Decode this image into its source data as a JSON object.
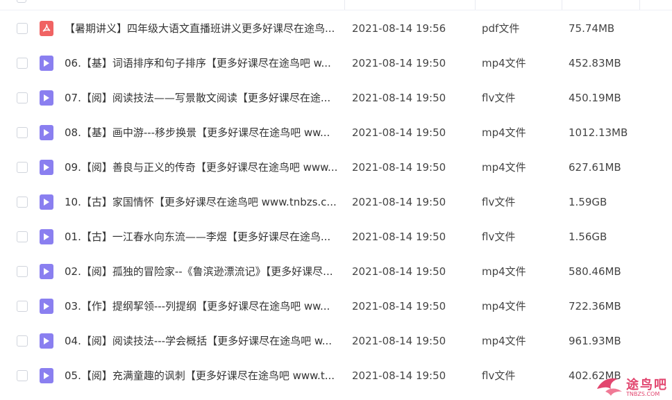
{
  "files": [
    {
      "name": "【暑期讲义】四年级大语文直播班讲义更多好课尽在途鸟...",
      "time": "2021-08-14 19:56",
      "type": "pdf文件",
      "size": "75.74MB",
      "icon": "pdf-file-icon"
    },
    {
      "name": "06.【基】词语排序和句子排序【更多好课尽在途鸟吧 w...",
      "time": "2021-08-14 19:50",
      "type": "mp4文件",
      "size": "452.83MB",
      "icon": "video-file-icon"
    },
    {
      "name": "07.【阅】阅读技法——写景散文阅读【更多好课尽在途...",
      "time": "2021-08-14 19:50",
      "type": "flv文件",
      "size": "450.19MB",
      "icon": "video-file-icon"
    },
    {
      "name": "08.【基】画中游---移步换景【更多好课尽在途鸟吧 ww...",
      "time": "2021-08-14 19:50",
      "type": "mp4文件",
      "size": "1012.13MB",
      "icon": "video-file-icon"
    },
    {
      "name": "09.【阅】善良与正义的传奇【更多好课尽在途鸟吧 www...",
      "time": "2021-08-14 19:50",
      "type": "mp4文件",
      "size": "627.61MB",
      "icon": "video-file-icon"
    },
    {
      "name": "10.【古】家国情怀【更多好课尽在途鸟吧 www.tnbzs.c...",
      "time": "2021-08-14 19:50",
      "type": "flv文件",
      "size": "1.59GB",
      "icon": "video-file-icon"
    },
    {
      "name": "01.【古】一江春水向东流——李煜【更多好课尽在途鸟...",
      "time": "2021-08-14 19:50",
      "type": "flv文件",
      "size": "1.56GB",
      "icon": "video-file-icon"
    },
    {
      "name": "02.【阅】孤独的冒险家--《鲁滨逊漂流记》【更多好课尽...",
      "time": "2021-08-14 19:50",
      "type": "mp4文件",
      "size": "580.46MB",
      "icon": "video-file-icon"
    },
    {
      "name": "03.【作】提纲挈领---列提纲【更多好课尽在途鸟吧 ww...",
      "time": "2021-08-14 19:50",
      "type": "mp4文件",
      "size": "722.36MB",
      "icon": "video-file-icon"
    },
    {
      "name": "04.【阅】阅读技法---学会概括【更多好课尽在途鸟吧 w...",
      "time": "2021-08-14 19:50",
      "type": "mp4文件",
      "size": "961.93MB",
      "icon": "video-file-icon"
    },
    {
      "name": "05.【阅】充满童趣的讽刺【更多好课尽在途鸟吧 www.t...",
      "time": "2021-08-14 19:50",
      "type": "flv文件",
      "size": "402.62MB",
      "icon": "video-file-icon"
    }
  ],
  "watermark": {
    "text": "途鸟吧",
    "url": "TNBZS.COM"
  },
  "colors": {
    "video_icon": "#8a7ff0",
    "pdf_icon": "#f06363",
    "watermark": "#e2466f"
  }
}
